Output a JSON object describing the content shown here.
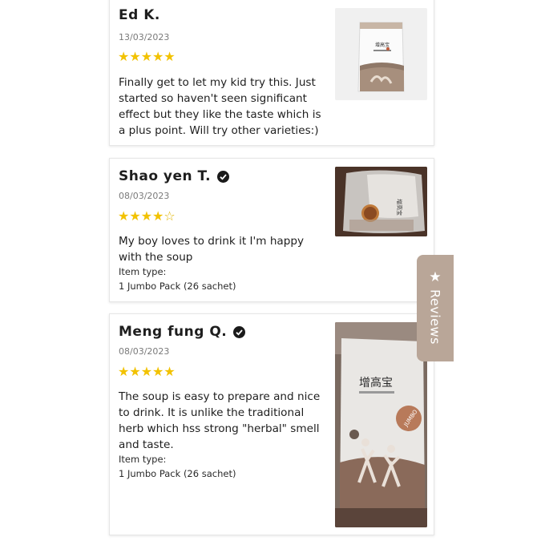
{
  "reviews": [
    {
      "name": "Ed K.",
      "verified": false,
      "date": "13/03/2023",
      "rating": 5,
      "stars_text": "★★★★★",
      "text": "Finally get to let my kid try this. Just started so haven't seen significant effect but they like the taste which is a plus point. Will try other varieties:)",
      "item_type_label": "",
      "item_type_value": "",
      "image_icon": "product-pouch-photo"
    },
    {
      "name": "Shao yen T.",
      "verified": true,
      "date": "08/03/2023",
      "rating": 4,
      "stars_filled": "★★★★",
      "stars_empty": "☆",
      "text": "My boy loves to drink it I'm happy with the soup",
      "item_type_label": "Item type:",
      "item_type_value": "1 Jumbo Pack (26 sachet)",
      "image_icon": "product-bag-photo"
    },
    {
      "name": "Meng fung Q.",
      "verified": true,
      "date": "08/03/2023",
      "rating": 5,
      "stars_text": "★★★★★",
      "text": "The soup is easy to prepare and nice to drink. It is unlike the traditional herb which hss strong \"herbal\" smell and taste.",
      "item_type_label": "Item type:",
      "item_type_value": "1 Jumbo Pack (26 sachet)",
      "image_icon": "jumbo-pack-photo"
    }
  ],
  "product": {
    "brand_cn": "增高宝",
    "badge": "JUMBO"
  },
  "reviews_tab": {
    "label": "Reviews",
    "icon": "star-icon"
  },
  "colors": {
    "star": "#f2c200",
    "tab_bg": "#b9a698",
    "text": "#1e1e1e",
    "date": "#7a7a7a"
  }
}
